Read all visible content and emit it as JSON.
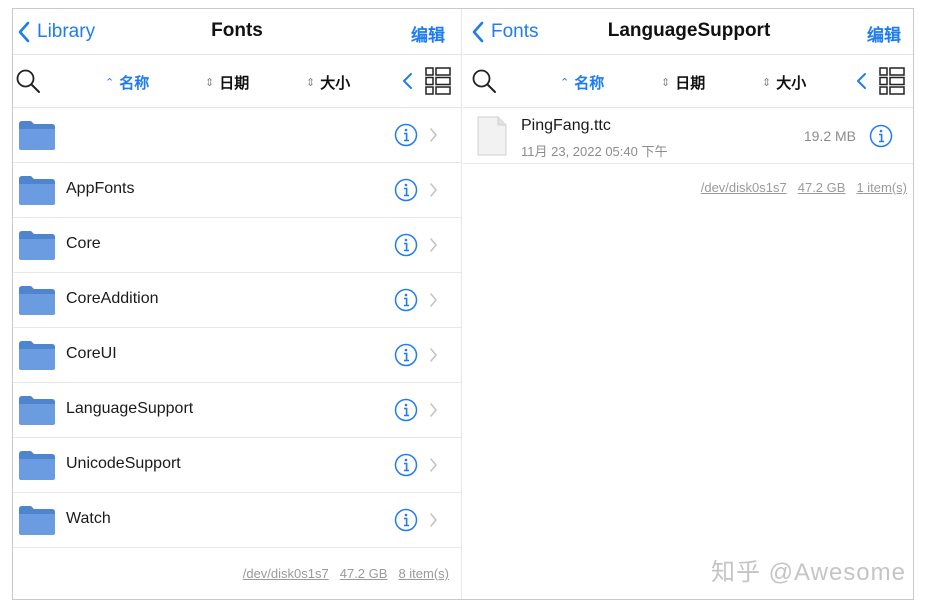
{
  "colors": {
    "accent": "#1f7cf0",
    "folder": "#5b8fd6",
    "folder_light": "#7faae6",
    "muted": "#8c8c8c"
  },
  "left": {
    "back_label": "Library",
    "title": "Fonts",
    "edit_label": "编辑",
    "sort": {
      "name": "名称",
      "date": "日期",
      "size": "大小"
    },
    "folders": [
      {
        "name": ""
      },
      {
        "name": "AppFonts"
      },
      {
        "name": "Core"
      },
      {
        "name": "CoreAddition"
      },
      {
        "name": "CoreUI"
      },
      {
        "name": "LanguageSupport"
      },
      {
        "name": "UnicodeSupport"
      },
      {
        "name": "Watch"
      }
    ],
    "footer": {
      "path": "/dev/disk0s1s7",
      "capacity": "47.2 GB",
      "count": "8 item(s)"
    }
  },
  "right": {
    "back_label": "Fonts",
    "title": "LanguageSupport",
    "edit_label": "编辑",
    "sort": {
      "name": "名称",
      "date": "日期",
      "size": "大小"
    },
    "files": [
      {
        "name": "PingFang.ttc",
        "date": "11月 23, 2022 05:40 下午",
        "size": "19.2 MB"
      }
    ],
    "footer": {
      "path": "/dev/disk0s1s7",
      "capacity": "47.2 GB",
      "count": "1 item(s)"
    }
  },
  "watermark": "知乎 @Awesome"
}
